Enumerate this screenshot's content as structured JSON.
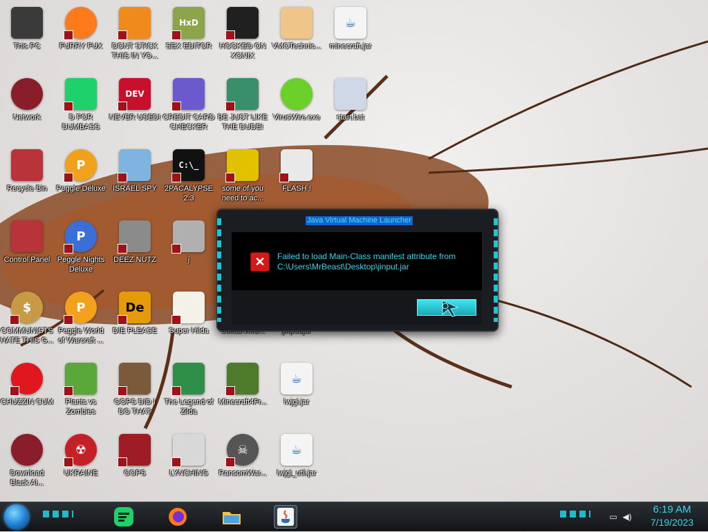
{
  "desktop": {
    "icons": [
      {
        "label": "This PC",
        "icon": "computer-icon",
        "color": "#3a3a3a"
      },
      {
        "label": "FURRY FUX",
        "icon": "firefox-icon",
        "color": "#ff7a1a"
      },
      {
        "label": "DONT STICK THIS IN YO...",
        "icon": "vlc-cone-icon",
        "color": "#f08a1c"
      },
      {
        "label": "SEX EDITOR",
        "icon": "hxd-hex-editor-icon",
        "color": "#8da54a"
      },
      {
        "label": "HOOKED ON XONIX",
        "icon": "xonix-game-icon",
        "color": "#202020"
      },
      {
        "label": "VMOTechnic...",
        "icon": "doctor-icon",
        "color": "#f0c58a"
      },
      {
        "label": "minecraft.jar",
        "icon": "java-icon",
        "color": "#f4f4f4"
      },
      {
        "label": "Network",
        "icon": "network-orb-icon",
        "color": "#8a1d2a"
      },
      {
        "label": "D FOR DUMBASS",
        "icon": "chat-bubble-icon",
        "color": "#1ed16b"
      },
      {
        "label": "NEVER USED!",
        "icon": "dev-cpp-icon",
        "color": "#c8102e"
      },
      {
        "label": "CREDIT CARD CHECKER",
        "icon": "credit-card-icon",
        "color": "#6a5acd"
      },
      {
        "label": "BE JUST LIKE THE DUDE!",
        "icon": "elf-icon",
        "color": "#3a8f6b"
      },
      {
        "label": "VirusWire.exe",
        "icon": "lime-icon",
        "color": "#6bd12a"
      },
      {
        "label": "start.bat",
        "icon": "batch-gear-icon",
        "color": "#cfd8e6"
      },
      {
        "label": "Recycle Bin",
        "icon": "recycle-bin-icon",
        "color": "#b8343a"
      },
      {
        "label": "Peggle Deluxe",
        "icon": "peggle-icon",
        "color": "#f2a11d"
      },
      {
        "label": "ISRAEL SPY",
        "icon": "spy-network-icon",
        "color": "#7fb3e0"
      },
      {
        "label": "2PACALYPSE 2.3",
        "icon": "terminal-icon",
        "color": "#111111"
      },
      {
        "label": "some of you need to ac...",
        "icon": "dog-icon",
        "color": "#e2c100"
      },
      {
        "label": "FLASH !",
        "icon": "flash-cards-icon",
        "color": "#e9e9e9"
      },
      {
        "label": "",
        "icon": "blank",
        "color": "transparent"
      },
      {
        "label": "Control Panel",
        "icon": "control-panel-icon",
        "color": "#b8343a"
      },
      {
        "label": "Peggle Nights Deluxe",
        "icon": "peggle-nights-icon",
        "color": "#3b6fd8"
      },
      {
        "label": "DEEZ NUTZ",
        "icon": "windows-stack-icon",
        "color": "#8b8b8b"
      },
      {
        "label": "j",
        "icon": "folder-book-icon",
        "color": "#b0b0b0"
      },
      {
        "label": "",
        "icon": "blank",
        "color": "transparent"
      },
      {
        "label": "",
        "icon": "blank",
        "color": "transparent"
      },
      {
        "label": "",
        "icon": "blank",
        "color": "transparent"
      },
      {
        "label": "COMMUNISTS HATE THIS G...",
        "icon": "money-bag-icon",
        "color": "#c89a46"
      },
      {
        "label": "Peggle World of Warcraft ...",
        "icon": "peggle-wow-icon",
        "color": "#f2a11d"
      },
      {
        "label": "DIE PLEASE",
        "icon": "de-letters-icon",
        "color": "#e39b0b"
      },
      {
        "label": "Super Hilda",
        "icon": "pixel-art-icon",
        "color": "#f4f1e8"
      },
      {
        "label": "Collab.vMB...",
        "icon": "blank",
        "color": "transparent"
      },
      {
        "label": "jinput.jar",
        "icon": "blank",
        "color": "transparent"
      },
      {
        "label": "",
        "icon": "blank",
        "color": "transparent"
      },
      {
        "label": "CHUZZIN CUM",
        "icon": "chuzzle-icon",
        "color": "#e0171f"
      },
      {
        "label": "Plants vs Zombies",
        "icon": "plant-icon",
        "color": "#5aa73a"
      },
      {
        "label": "OOPS DID I DO THAT",
        "icon": "portrait-icon",
        "color": "#7b5a3c"
      },
      {
        "label": "The Legend of Zilda",
        "icon": "zelda-pixel-icon",
        "color": "#2f8f4a"
      },
      {
        "label": "Minecraft4Fr...",
        "icon": "grass-block-icon",
        "color": "#4e7a2c"
      },
      {
        "label": "lwjgl.jar",
        "icon": "java-icon",
        "color": "#f4f4f4"
      },
      {
        "label": "",
        "icon": "blank",
        "color": "transparent"
      },
      {
        "label": "Download Black Al...",
        "icon": "network-orb-icon",
        "color": "#8a1d2a"
      },
      {
        "label": "UKRAINE",
        "icon": "radiation-icon",
        "color": "#c42027"
      },
      {
        "label": "OOPS",
        "icon": "game-box-icon",
        "color": "#9d1c25"
      },
      {
        "label": "LYNCHING",
        "icon": "noose-icon",
        "color": "#d8d8d8"
      },
      {
        "label": "RansomWar...",
        "icon": "skull-icon",
        "color": "#555555"
      },
      {
        "label": "lwjgl_util.jar",
        "icon": "java-icon",
        "color": "#f4f4f4"
      },
      {
        "label": "",
        "icon": "blank",
        "color": "transparent"
      }
    ]
  },
  "dialog": {
    "title": "Java Virtual Machine Launcher",
    "message": "Failed to load Main-Class manifest attribute from C:\\Users\\MrBeast\\Desktop\\jinput.jar",
    "error_icon": "error-x-icon",
    "ok_button_icon": "cursor-arrow-icon"
  },
  "taskbar": {
    "start_icon": "start-orb-icon",
    "pinned": [
      {
        "name": "chat-app",
        "icon": "chat-bubble-icon",
        "color": "#1ed16b",
        "active": false
      },
      {
        "name": "firefox",
        "icon": "firefox-icon",
        "color": "#ff7a1a",
        "active": false
      },
      {
        "name": "file-explorer",
        "icon": "folder-icon",
        "color": "#f2c14e",
        "active": false
      },
      {
        "name": "java",
        "icon": "java-icon",
        "color": "#f4f4f4",
        "active": true
      }
    ],
    "tray_icons": [
      "network-icon",
      "volume-icon"
    ],
    "time": "6:19 AM",
    "date": "7/19/2023",
    "accent": "#35d6ee"
  }
}
